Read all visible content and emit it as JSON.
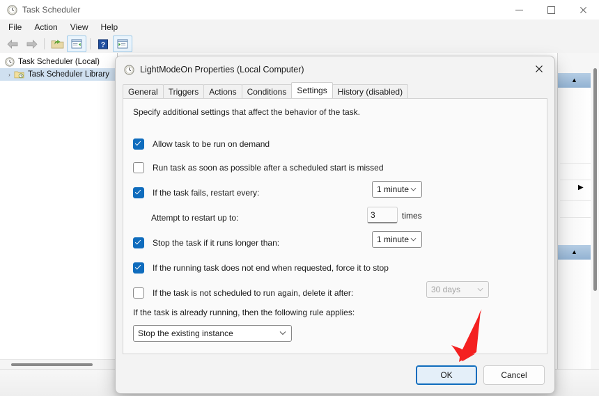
{
  "window": {
    "title": "Task Scheduler",
    "icon": "clock-icon",
    "controls": {
      "minimize": "–",
      "maximize": "□",
      "close": "✕"
    }
  },
  "menu": {
    "items": [
      "File",
      "Action",
      "View",
      "Help"
    ]
  },
  "toolbar": {
    "items": [
      {
        "name": "back-arrow-icon",
        "glyph": "←"
      },
      {
        "name": "forward-arrow-icon",
        "glyph": "→"
      },
      {
        "name": "open-folder-icon",
        "glyph": "📂"
      },
      {
        "name": "show-list-pane-icon",
        "glyph": "▤"
      },
      {
        "name": "help-icon",
        "glyph": "?"
      },
      {
        "name": "show-action-pane-icon",
        "glyph": "▥"
      }
    ]
  },
  "tree": {
    "root": {
      "label": "Task Scheduler (Local)",
      "icon": "clock-icon"
    },
    "child": {
      "label": "Task Scheduler Library",
      "icon": "folder-clock-icon",
      "expander": "›",
      "selected": true
    }
  },
  "right_pane": {
    "collapse_caret": "▲",
    "expand_arrow": "▶"
  },
  "dialog": {
    "title": "LightModeOn Properties (Local Computer)",
    "icon": "clock-icon",
    "close_glyph": "✕",
    "tabs": [
      {
        "label": "General",
        "active": false
      },
      {
        "label": "Triggers",
        "active": false
      },
      {
        "label": "Actions",
        "active": false
      },
      {
        "label": "Conditions",
        "active": false
      },
      {
        "label": "Settings",
        "active": true
      },
      {
        "label": "History (disabled)",
        "active": false
      }
    ],
    "intro": "Specify additional settings that affect the behavior of the task.",
    "settings": {
      "allow_on_demand": {
        "label": "Allow task to be run on demand",
        "checked": true
      },
      "run_asap_after_missed": {
        "label": "Run task as soon as possible after a scheduled start is missed",
        "checked": false
      },
      "restart_on_failure": {
        "label": "If the task fails, restart every:",
        "checked": true,
        "interval": "1 minute"
      },
      "restart_attempts": {
        "label": "Attempt to restart up to:",
        "value": "3",
        "suffix": "times"
      },
      "stop_if_runs_longer": {
        "label": "Stop the task if it runs longer than:",
        "checked": true,
        "duration": "1 minute"
      },
      "force_stop": {
        "label": "If the running task does not end when requested, force it to stop",
        "checked": true
      },
      "delete_if_not_scheduled": {
        "label": "If the task is not scheduled to run again, delete it after:",
        "checked": false,
        "duration": "30 days",
        "disabled": true
      },
      "already_running_label": "If the task is already running, then the following rule applies:",
      "already_running_rule": "Stop the existing instance"
    },
    "buttons": {
      "ok": "OK",
      "cancel": "Cancel"
    },
    "caret_glyph": "⌄"
  },
  "annotation": {
    "arrow_color": "#f42020"
  }
}
